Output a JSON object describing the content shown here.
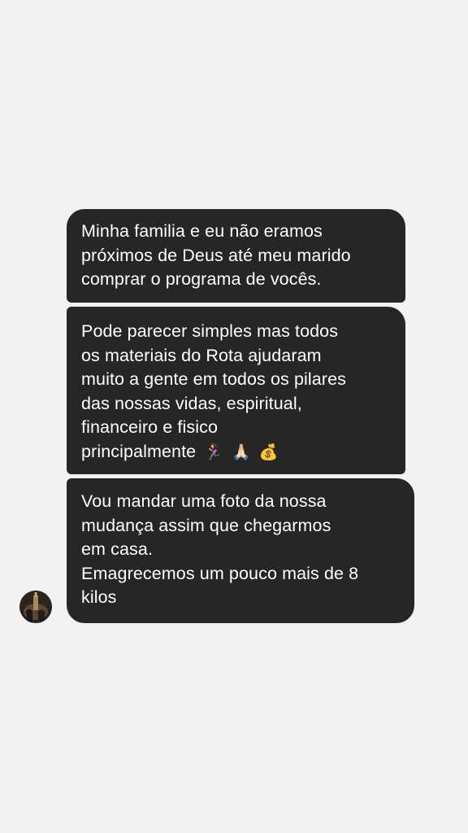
{
  "conversation": {
    "messages": [
      {
        "lines": [
          "Minha familia e eu não eramos",
          "próximos de Deus até meu marido",
          "comprar o programa de vocês."
        ]
      },
      {
        "lines": [
          "Pode parecer simples mas todos",
          "os materiais do Rota ajudaram",
          "muito a gente em todos os pilares",
          "das nossas vidas, espiritual,",
          "financeiro e fisico",
          "principalmente"
        ],
        "emojis": [
          "🏃‍♀️",
          "🙏🏻",
          "💰"
        ]
      },
      {
        "lines": [
          "Vou mandar uma foto da nossa",
          "mudança assim que chegarmos",
          "em casa.",
          "Emagrecemos um pouco mais de 8",
          "kilos"
        ]
      }
    ],
    "colors": {
      "background": "#f2f2f2",
      "bubble": "#262626",
      "text": "#ffffff"
    },
    "avatar_icon": "sender-avatar-photo"
  }
}
